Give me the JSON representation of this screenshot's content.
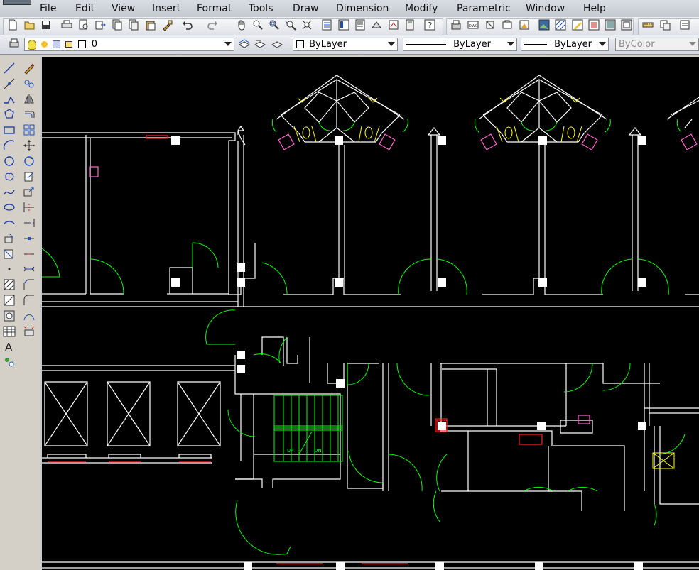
{
  "menubar": {
    "items": [
      "File",
      "Edit",
      "View",
      "Insert",
      "Format",
      "Tools",
      "Draw",
      "Dimension",
      "Modify",
      "Parametric",
      "Window",
      "Help"
    ]
  },
  "toolbar_icons": {
    "standard": [
      "new-icon",
      "open-icon",
      "save-icon",
      "plot-icon",
      "plot-preview-icon",
      "publish-icon",
      "cut-icon",
      "copy-icon",
      "paste-icon",
      "match-properties-icon",
      "undo-icon",
      "redo-icon",
      "pan-icon",
      "zoom-realtime-icon",
      "zoom-window-icon",
      "zoom-previous-icon",
      "properties-icon",
      "design-center-icon",
      "tool-palettes-icon",
      "sheet-set-icon",
      "markup-icon",
      "calculator-icon",
      "help-icon"
    ],
    "extra": [
      "layer-state-icon",
      "dwg-icon",
      "block-icon",
      "attribute-icon",
      "image-icon",
      "raster-icon",
      "hatch-icon",
      "gradient-icon",
      "region-icon",
      "measure-icon",
      "clip-icon",
      "publish-dwf-icon"
    ]
  },
  "layers": {
    "current_layer": "0",
    "color": "ByLayer",
    "linetype": "ByLayer",
    "lineweight": "ByLayer",
    "plotstyle": "ByColor"
  },
  "draw_tools": [
    "line-icon",
    "construction-line-icon",
    "polyline-icon",
    "polygon-icon",
    "rectangle-icon",
    "arc-icon",
    "circle-icon",
    "revision-cloud-icon",
    "spline-icon",
    "ellipse-icon",
    "ellipse-arc-icon",
    "insert-block-icon",
    "make-block-icon",
    "point-icon",
    "hatch-icon",
    "gradient-icon",
    "region-icon",
    "table-icon",
    "multiline-text-icon",
    "add-selected-icon"
  ],
  "modify_tools": [
    "erase-icon",
    "copy-object-icon",
    "mirror-icon",
    "offset-icon",
    "array-icon",
    "move-icon",
    "rotate-icon",
    "scale-icon",
    "stretch-icon",
    "trim-icon",
    "extend-icon",
    "break-at-point-icon",
    "break-icon",
    "join-icon",
    "chamfer-icon",
    "fillet-icon",
    "blend-curves-icon",
    "explode-icon"
  ],
  "drawing": {
    "stair_up_label": "UP",
    "stair_down_label": "DN",
    "colors": {
      "walls": "#ffffff",
      "doors": "#00ff00",
      "fixtures": "#ffff00",
      "equipment": "#ff66cc",
      "red_items": "#ff2020",
      "background": "#000000"
    }
  }
}
